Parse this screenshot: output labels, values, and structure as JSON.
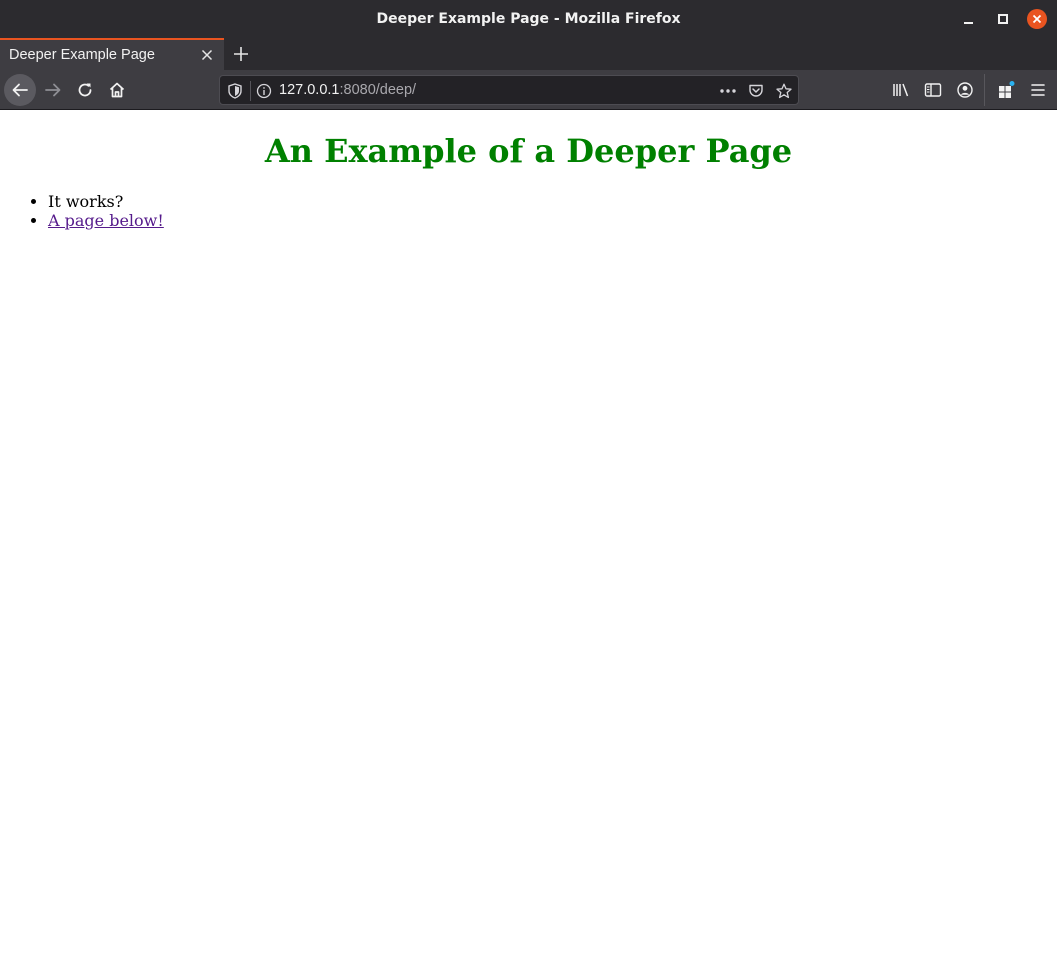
{
  "window": {
    "title": "Deeper Example Page - Mozilla Firefox"
  },
  "tabs": [
    {
      "label": "Deeper Example Page",
      "active": true
    }
  ],
  "address_bar": {
    "host": "127.0.0.1",
    "rest": ":8080/deep/"
  },
  "page": {
    "heading": "An Example of a Deeper Page",
    "heading_color": "#008000",
    "list_items": [
      {
        "text": "It works?"
      },
      {
        "text": "A page below!",
        "is_link": true,
        "link_color": "#551a8b"
      }
    ]
  },
  "colors": {
    "accent": "#e95420",
    "chrome_dark": "#2c2b2f",
    "toolbar": "#3e3d42"
  },
  "icons": {
    "window_controls": [
      "minimize-icon",
      "maximize-icon",
      "close-icon"
    ],
    "nav": [
      "back-arrow-icon",
      "forward-arrow-icon",
      "reload-icon",
      "home-icon"
    ],
    "urlbar": [
      "shield-icon",
      "info-icon",
      "more-dots-icon",
      "pocket-icon",
      "star-icon"
    ],
    "toolbar": [
      "library-icon",
      "sidebar-icon",
      "account-icon",
      "extensions-icon",
      "hamburger-menu-icon"
    ]
  }
}
